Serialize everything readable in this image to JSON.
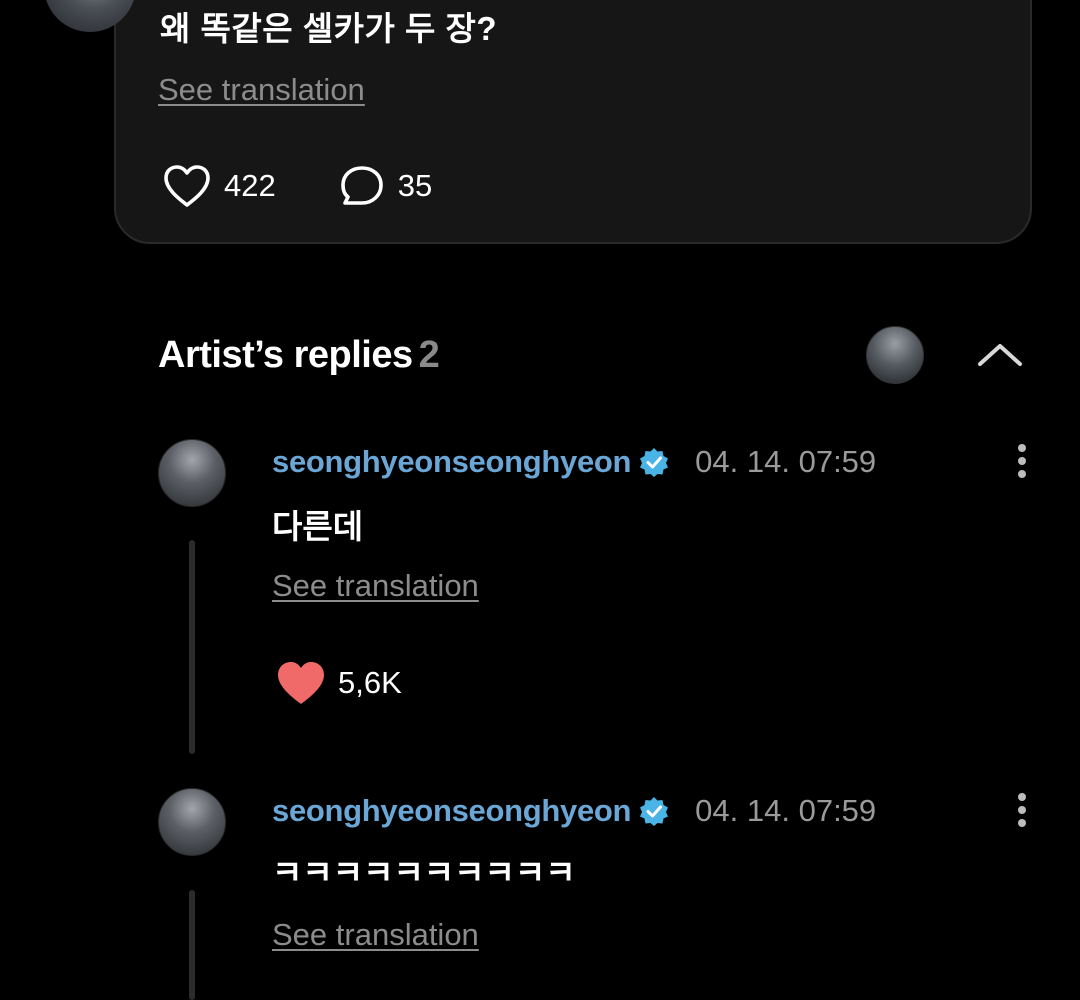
{
  "post": {
    "text": "왜 똑같은 셀카가 두 장?",
    "see_translation": "See translation",
    "likes": "422",
    "comments": "35"
  },
  "artist_replies": {
    "title": "Artist’s replies",
    "count": "2"
  },
  "replies": [
    {
      "username": "seonghyeonseonghyeon",
      "timestamp": "04. 14. 07:59",
      "text": "다른데",
      "see_translation": "See translation",
      "likes": "5,6K",
      "liked": true
    },
    {
      "username": "seonghyeonseonghyeon",
      "timestamp": "04. 14. 07:59",
      "text": "ㅋㅋㅋㅋㅋㅋㅋㅋㅋㅋ",
      "see_translation": "See translation"
    }
  ],
  "colors": {
    "background": "#000000",
    "card": "#161616",
    "username": "#6aa7d6",
    "verified": "#4ab4e6",
    "liked_heart": "#f06a6a",
    "muted_text": "#8c8c8c"
  },
  "icons": {
    "like": "heart-outline-icon",
    "comment": "speech-bubble-icon",
    "liked": "heart-filled-icon",
    "verified": "verified-badge-icon",
    "more": "vertical-ellipsis-icon",
    "collapse": "chevron-up-icon"
  }
}
